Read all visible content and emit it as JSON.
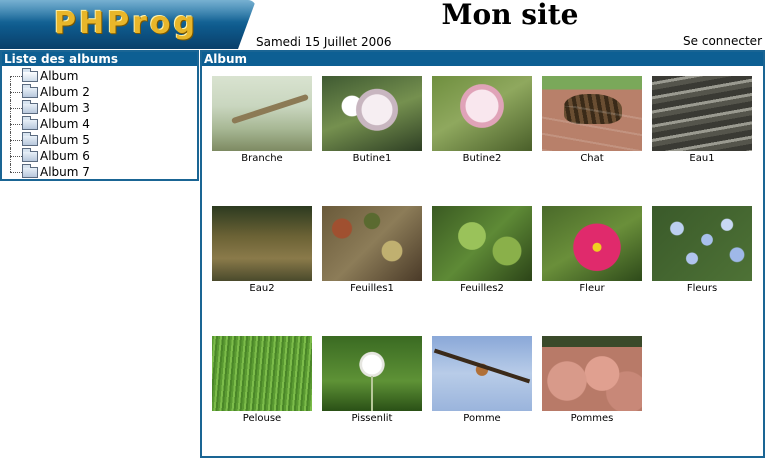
{
  "header": {
    "logo_text": "PHProg",
    "site_title": "Mon site",
    "date": "Samedi 15 Juillet 2006",
    "login_label": "Se connecter"
  },
  "sidebar": {
    "title": "Liste des albums",
    "items": [
      {
        "label": "Album"
      },
      {
        "label": "Album 2"
      },
      {
        "label": "Album 3"
      },
      {
        "label": "Album 4"
      },
      {
        "label": "Album 5"
      },
      {
        "label": "Album 6"
      },
      {
        "label": "Album 7"
      }
    ]
  },
  "album": {
    "title": "Album",
    "photos": [
      {
        "caption": "Branche"
      },
      {
        "caption": "Butine1"
      },
      {
        "caption": "Butine2"
      },
      {
        "caption": "Chat"
      },
      {
        "caption": "Eau1"
      },
      {
        "caption": "Eau2"
      },
      {
        "caption": "Feuilles1"
      },
      {
        "caption": "Feuilles2"
      },
      {
        "caption": "Fleur"
      },
      {
        "caption": "Fleurs"
      },
      {
        "caption": "Pelouse"
      },
      {
        "caption": "Pissenlit"
      },
      {
        "caption": "Pomme"
      },
      {
        "caption": "Pommes"
      }
    ]
  },
  "colors": {
    "panel_header": "#0d5f93",
    "border": "#1a6594",
    "logo_gold": "#e8b62a"
  }
}
